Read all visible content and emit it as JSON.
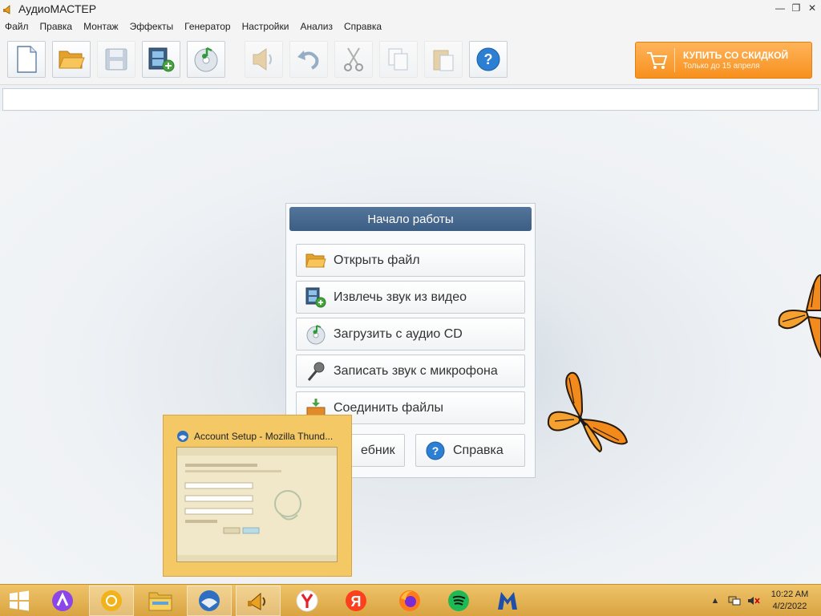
{
  "window": {
    "title": "АудиоМАСТЕР"
  },
  "menu": [
    "Файл",
    "Правка",
    "Монтаж",
    "Эффекты",
    "Генератор",
    "Настройки",
    "Анализ",
    "Справка"
  ],
  "toolbar": {
    "buy_title": "КУПИТЬ СО СКИДКОЙ",
    "buy_subtitle": "Только до 15 апреля"
  },
  "start_panel": {
    "title": "Начало работы",
    "open_file": "Открыть файл",
    "extract_audio": "Извлечь звук из видео",
    "load_cd": "Загрузить с аудио CD",
    "record_mic": "Записать звук с микрофона",
    "join_files": "Соединить файлы",
    "tutorial": "ебник",
    "help": "Справка"
  },
  "thumbnail": {
    "title": "Account Setup - Mozilla Thund..."
  },
  "taskbar": {
    "time": "10:22 AM",
    "date": "4/2/2022"
  },
  "colors": {
    "buy_button": "#f7901e",
    "panel_header": "#466a90",
    "taskbar": "#e3b04f"
  }
}
